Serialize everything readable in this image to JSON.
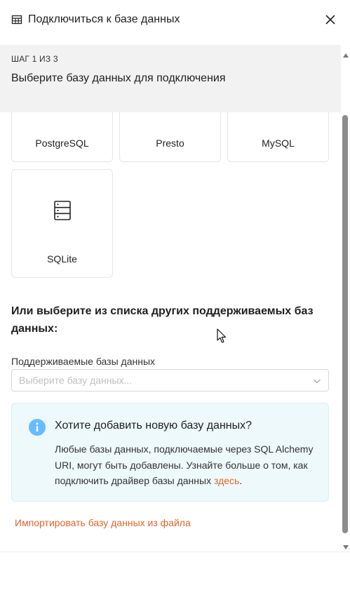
{
  "header": {
    "title": "Подключиться к базе данных",
    "title_icon": "table-icon",
    "close_icon": "close-icon"
  },
  "step": {
    "label": "ШАГ 1 ИЗ 3",
    "subtitle": "Выберите базу данных для подключения"
  },
  "databases": [
    {
      "label": "PostgreSQL"
    },
    {
      "label": "Presto"
    },
    {
      "label": "MySQL"
    },
    {
      "label": "SQLite",
      "icon": "database-server-icon"
    }
  ],
  "other": {
    "heading": "Или выберите из списка других поддерживаемых баз данных:",
    "select_label": "Поддерживаемые базы данных",
    "select_placeholder": "Выберите базу данных..."
  },
  "info": {
    "title": "Хотите добавить новую базу данных?",
    "body": "Любые базы данных, подключаемые через SQL Alchemy URI, могут быть добавлены. Узнайте больше о том, как подключить драйвер базы данных ",
    "link": "здесь",
    "end": "."
  },
  "import_link": "Импортировать базу данных из файла",
  "colors": {
    "accent": "#e0662b",
    "info_bg": "#eef9fb",
    "info_icon": "#66bcfe",
    "step_bg": "#f2f2f2"
  }
}
